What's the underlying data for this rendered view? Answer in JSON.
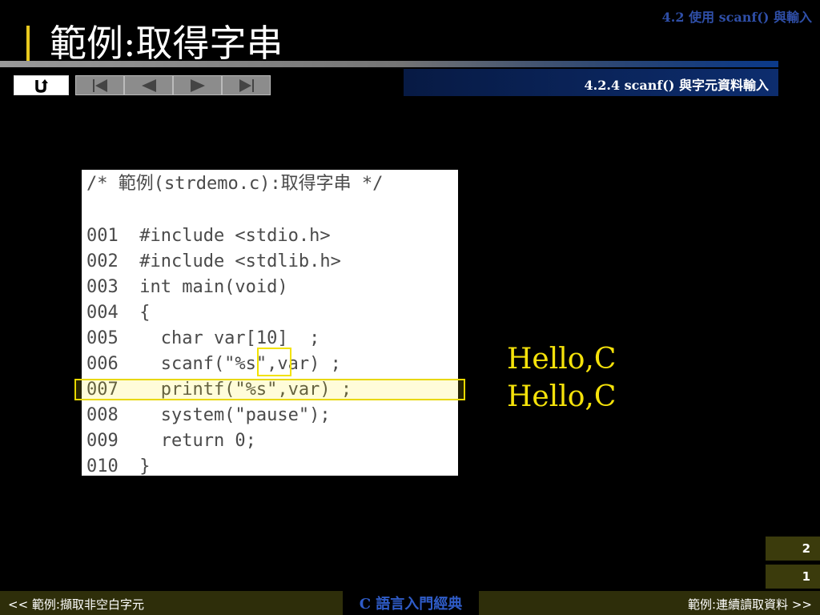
{
  "header": {
    "section": "4.2  使用 scanf() 與輸入",
    "title": "範例:取得字串",
    "subsection": "4.2.4 scanf() 與字元資料輸入"
  },
  "nav": {
    "icons": [
      "return-icon",
      "first-slide-icon",
      "previous-slide-icon",
      "next-slide-icon",
      "last-slide-icon"
    ]
  },
  "code": {
    "comment": "/* 範例(strdemo.c):取得字串 */",
    "lines": [
      "001  #include <stdio.h>",
      "002  #include <stdlib.h>",
      "003  int main(void)",
      "004  {",
      "005    char var[10]  ;",
      "006    scanf(\"%s\",var) ;",
      "007    printf(\"%s\",var) ;",
      "008    system(\"pause\");",
      "009    return 0;",
      "010  }"
    ]
  },
  "output": {
    "lines": [
      "Hello,C",
      "Hello,C"
    ]
  },
  "pages": {
    "upper": "2",
    "lower": "1"
  },
  "footer": {
    "prev": "<< 範例:擷取非空白字元",
    "book": "C 語言入門經典",
    "next": "範例:連續讀取資料 >>"
  },
  "colors": {
    "highlight": "#f2e200",
    "title_accent": "#e8c81e",
    "section_blue": "#2f4fa8"
  }
}
